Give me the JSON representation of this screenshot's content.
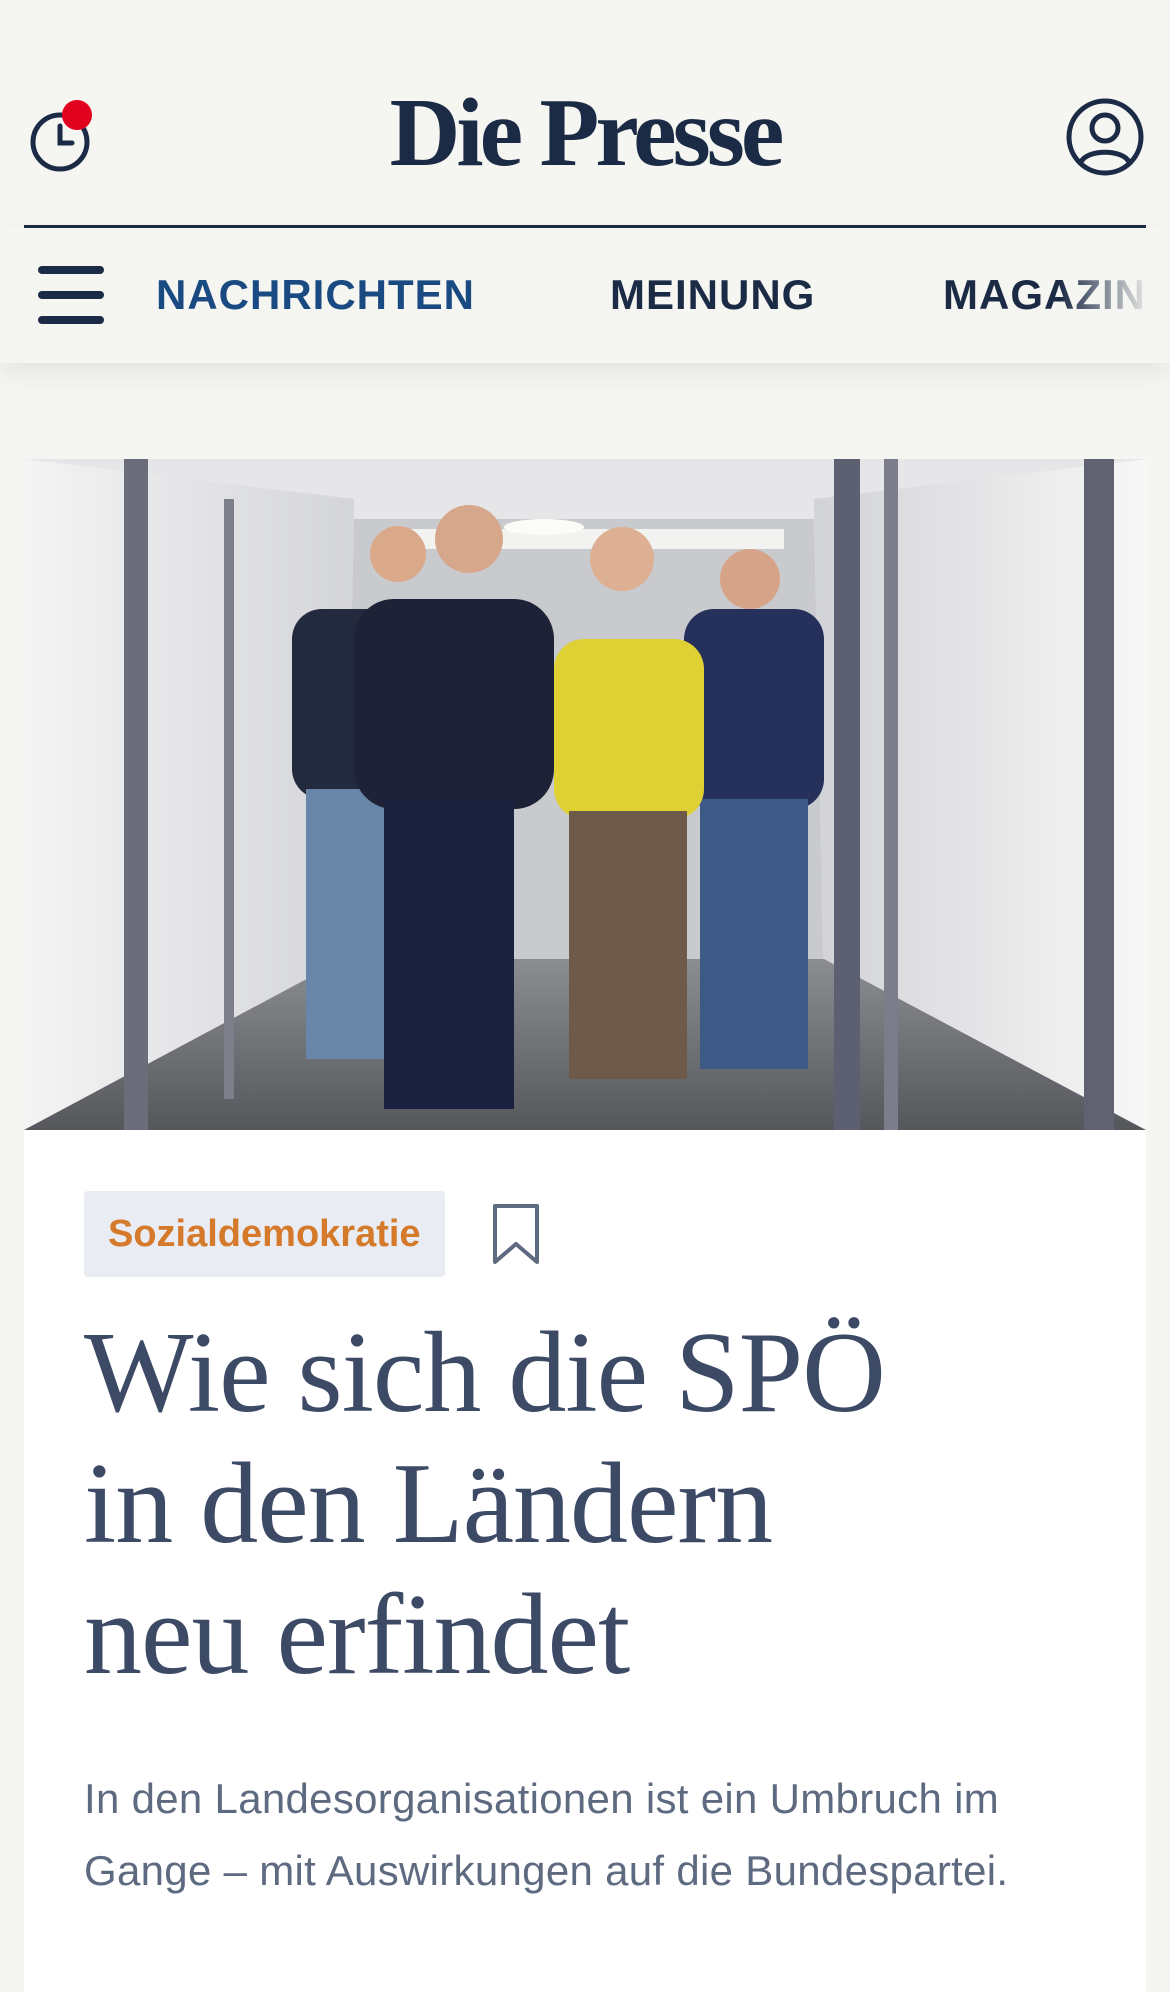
{
  "header": {
    "logo": "Die Presse",
    "history_icon": "clock-history-icon",
    "account_icon": "user-account-icon",
    "notification_dot_color": "#e1001e"
  },
  "nav": {
    "menu_icon": "hamburger-menu-icon",
    "items": [
      {
        "label": "NACHRICHTEN",
        "active": true
      },
      {
        "label": "MEINUNG",
        "active": false
      },
      {
        "label": "MAGAZIN",
        "active": false
      }
    ]
  },
  "article": {
    "image_icon": "article-photo",
    "category": "Sozialdemokratie",
    "bookmark_icon": "bookmark-icon",
    "headline_lines": [
      "Wie sich die SPÖ",
      "in den Ländern",
      "neu erfindet"
    ],
    "lead": "In den Landesorganisationen ist ein Umbruch im Gange – mit Auswirkungen auf die Bundespartei."
  },
  "colors": {
    "brand_navy": "#1b2a45",
    "nav_active": "#1a4a82",
    "category_orange": "#d5792b",
    "headline": "#3d4a66"
  }
}
